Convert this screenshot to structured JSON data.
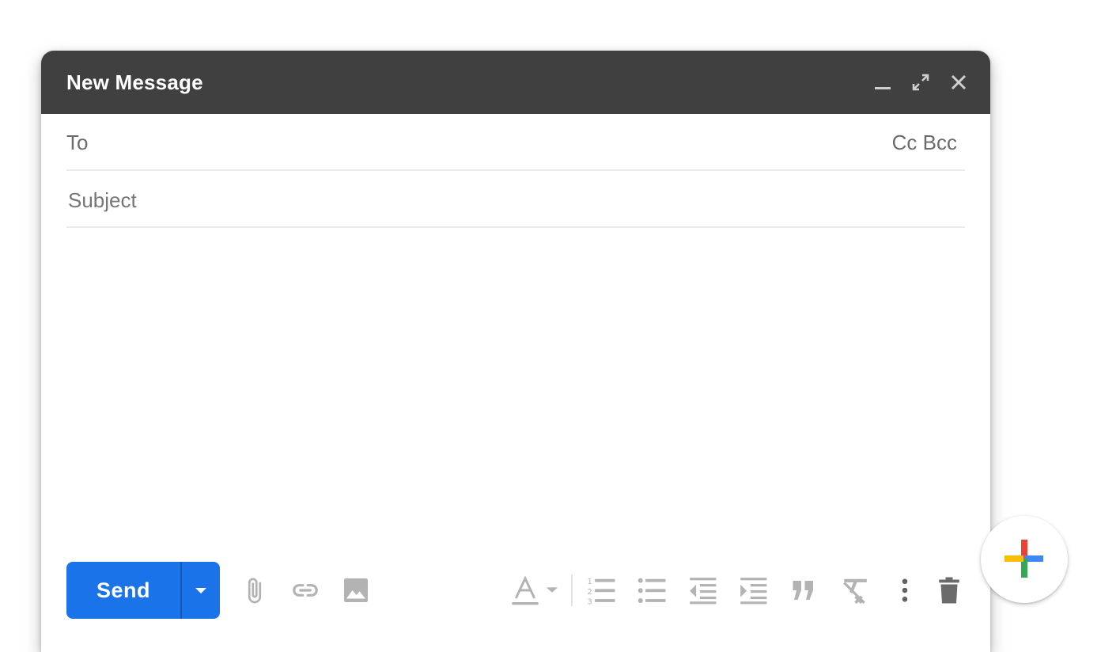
{
  "compose": {
    "title": "New Message",
    "to_label": "To",
    "to_value": "",
    "cc_label": "Cc",
    "bcc_label": "Bcc",
    "subject_placeholder": "Subject",
    "subject_value": "",
    "body_value": "",
    "send_label": "Send"
  },
  "titlebar_icons": [
    "minimize-icon",
    "fullscreen-icon",
    "close-icon"
  ],
  "toolbar_icons": [
    "attach-file-icon",
    "insert-link-icon",
    "insert-photo-icon",
    "text-color-icon",
    "numbered-list-icon",
    "bulleted-list-icon",
    "indent-less-icon",
    "indent-more-icon",
    "quote-icon",
    "remove-formatting-icon",
    "more-options-icon",
    "discard-draft-icon"
  ],
  "colors": {
    "titlebar_bg": "#404040",
    "send_blue": "#1a73e8",
    "icon_gray": "#b3b3b3",
    "fab_red": "#ea4335",
    "fab_blue": "#4285f4",
    "fab_yellow": "#fbbc04",
    "fab_green": "#34a853"
  }
}
